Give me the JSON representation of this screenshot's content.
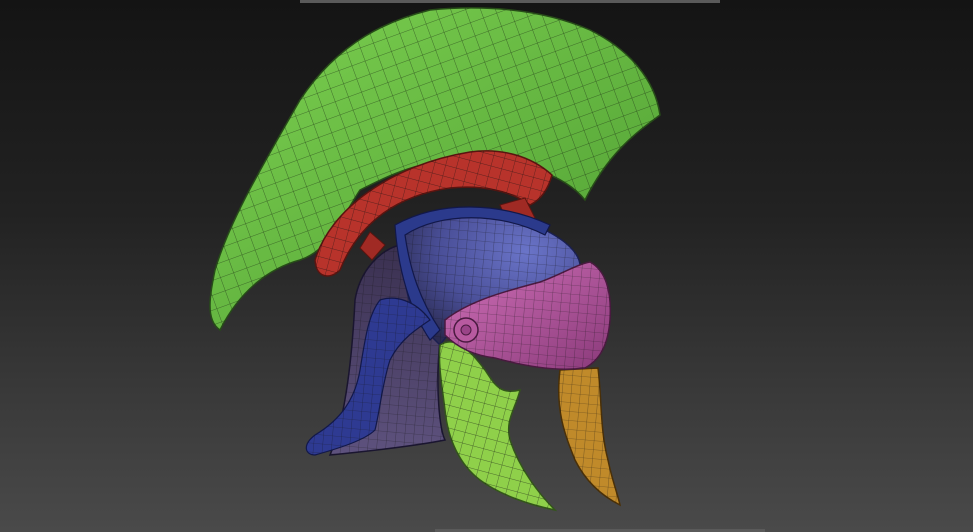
{
  "app": {
    "viewport": {
      "background": {
        "top": "#141414",
        "bottom": "#4a4a4a"
      }
    },
    "model": {
      "name": "",
      "polygroups": [
        {
          "part": "crest-plume",
          "color": "#6bbf45"
        },
        {
          "part": "crest-holder",
          "color": "#b8332b"
        },
        {
          "part": "helmet-bowl",
          "color": "#4a5aa8"
        },
        {
          "part": "helmet-rim",
          "color": "#2b3a8c"
        },
        {
          "part": "visor",
          "color": "#c05aa6"
        },
        {
          "part": "cheek-guard-left",
          "color": "#8fd04a"
        },
        {
          "part": "cheek-guard-right",
          "color": "#c08a2a"
        },
        {
          "part": "neck-guard",
          "color": "#5a4a7a"
        }
      ],
      "wireframe": true
    }
  }
}
